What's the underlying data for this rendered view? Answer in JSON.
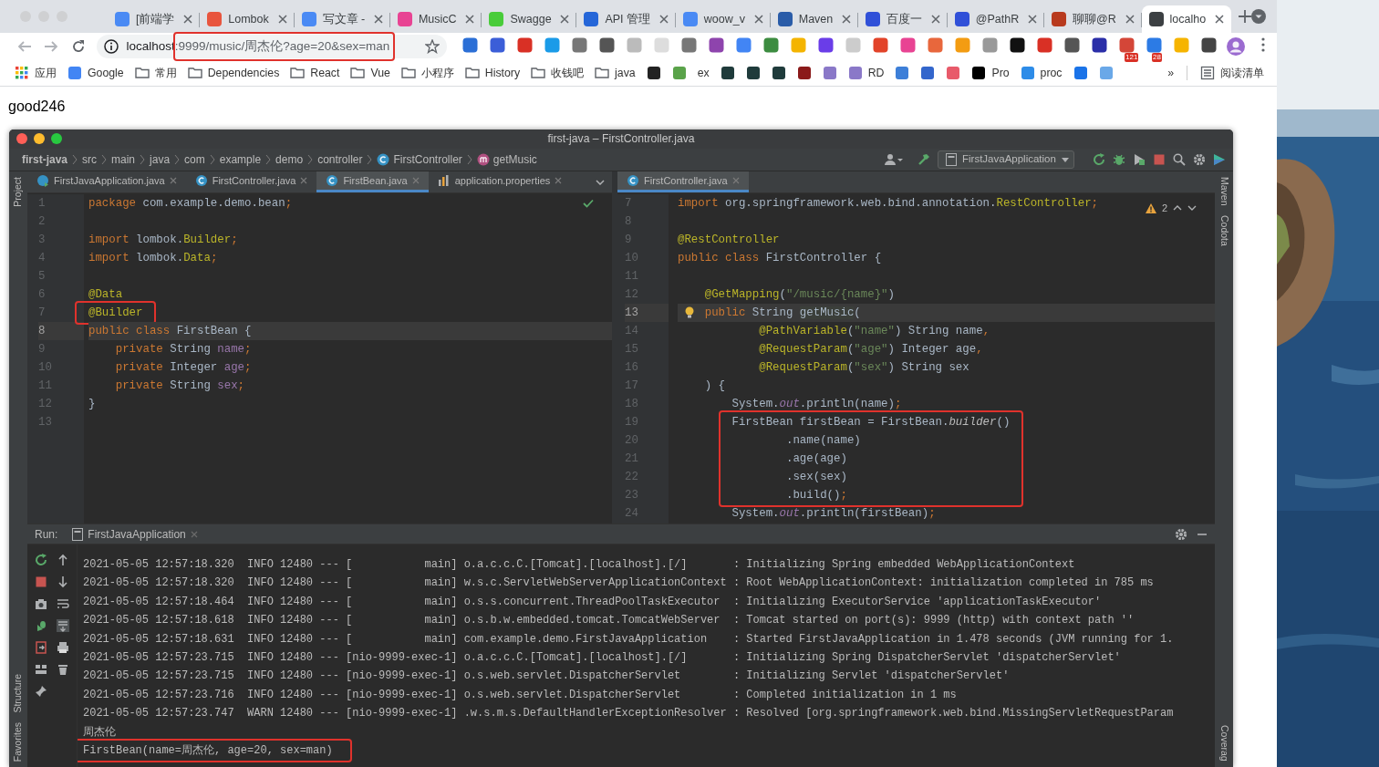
{
  "browser": {
    "tabs": [
      {
        "title": "[前端学",
        "color": "#4a8af4",
        "selected": false
      },
      {
        "title": "Lombok",
        "color": "#e8553e",
        "selected": false
      },
      {
        "title": "写文章 -",
        "color": "#4a8af4",
        "selected": false
      },
      {
        "title": "MusicC",
        "color": "#e84393",
        "selected": false
      },
      {
        "title": "Swagge",
        "color": "#49cc3a",
        "selected": false
      },
      {
        "title": "API 管理",
        "color": "#2566d8",
        "selected": false
      },
      {
        "title": "woow_v",
        "color": "#4a8af4",
        "selected": false
      },
      {
        "title": "Maven",
        "color": "#2a5ca8",
        "selected": false
      },
      {
        "title": "百度一",
        "color": "#3050d8",
        "selected": false
      },
      {
        "title": "@PathR",
        "color": "#3050d8",
        "selected": false
      },
      {
        "title": "聊聊@R",
        "color": "#b83a1e",
        "selected": false
      },
      {
        "title": "localho",
        "color": "#3c4043",
        "selected": true
      }
    ],
    "address": {
      "host": "localhost",
      "rest": ":9999/music/周杰伦?age=20&sex=man",
      "highlighted": true
    },
    "extensions": [
      {
        "color": "#2b6fd6"
      },
      {
        "color": "#3b5ed8"
      },
      {
        "color": "#d93025"
      },
      {
        "color": "#1a9be8"
      },
      {
        "color": "#777777"
      },
      {
        "color": "#555555"
      },
      {
        "color": "#bbbbbb"
      },
      {
        "color": "#dddddd"
      },
      {
        "color": "#777777"
      },
      {
        "color": "#8e44ad"
      },
      {
        "color": "#4285f4"
      },
      {
        "color": "#3c8c40"
      },
      {
        "color": "#f4b400"
      },
      {
        "color": "#6a3de8"
      },
      {
        "color": "#cccccc"
      },
      {
        "color": "#e24329"
      },
      {
        "color": "#e84393"
      },
      {
        "color": "#e8673c"
      },
      {
        "color": "#f39c12"
      },
      {
        "color": "#999999"
      },
      {
        "color": "#111111"
      },
      {
        "color": "#d93025"
      },
      {
        "color": "#555555"
      },
      {
        "color": "#2a2ea8"
      },
      {
        "color": "#d44638",
        "badge": "121"
      },
      {
        "color": "#2c7be5",
        "badge": "28"
      },
      {
        "color": "#f6b400"
      },
      {
        "color": "#444444"
      }
    ],
    "bookmarks": [
      {
        "kind": "apps",
        "label": "应用"
      },
      {
        "kind": "site",
        "label": "Google",
        "color": "#4285f4"
      },
      {
        "kind": "folder",
        "label": "常用"
      },
      {
        "kind": "folder",
        "label": "Dependencies"
      },
      {
        "kind": "folder",
        "label": "React"
      },
      {
        "kind": "folder",
        "label": "Vue"
      },
      {
        "kind": "folder",
        "label": "小程序"
      },
      {
        "kind": "folder",
        "label": "History"
      },
      {
        "kind": "folder",
        "label": "收钱吧"
      },
      {
        "kind": "folder",
        "label": "java"
      },
      {
        "kind": "site",
        "color": "#222222"
      },
      {
        "kind": "site",
        "color": "#5aa34a"
      },
      {
        "kind": "site",
        "label": "ex"
      },
      {
        "kind": "site",
        "color": "#1f3b3b"
      },
      {
        "kind": "site",
        "color": "#1f3b3b"
      },
      {
        "kind": "site",
        "color": "#1f3b3b"
      },
      {
        "kind": "site",
        "color": "#8b1a1a"
      },
      {
        "kind": "site",
        "color": "#8a78c8"
      },
      {
        "kind": "site",
        "label": "RD",
        "color": "#8a78c8"
      },
      {
        "kind": "site",
        "color": "#3d7fd8"
      },
      {
        "kind": "site",
        "color": "#3366cc"
      },
      {
        "kind": "site",
        "color": "#e85a6a"
      },
      {
        "kind": "site",
        "label": "Pro",
        "color": "#000000"
      },
      {
        "kind": "site",
        "label": "proc",
        "color": "#2d8ce8"
      },
      {
        "kind": "site",
        "color": "#1a73e8"
      },
      {
        "kind": "site",
        "color": "#6aa8e8"
      }
    ],
    "more": "»",
    "reading_list": "阅读清单"
  },
  "page": {
    "text": "good246"
  },
  "ide": {
    "title": "first-java – FirstController.java",
    "breadcrumbs": [
      {
        "label": "first-java",
        "kind": "project"
      },
      {
        "label": "src",
        "kind": "dir"
      },
      {
        "label": "main",
        "kind": "dir"
      },
      {
        "label": "java",
        "kind": "dir"
      },
      {
        "label": "com",
        "kind": "dir"
      },
      {
        "label": "example",
        "kind": "dir"
      },
      {
        "label": "demo",
        "kind": "dir"
      },
      {
        "label": "controller",
        "kind": "dir"
      },
      {
        "label": "FirstController",
        "kind": "class"
      },
      {
        "label": "getMusic",
        "kind": "method"
      }
    ],
    "run_config": "FirstJavaApplication",
    "left_strip": {
      "top": [
        "Project"
      ],
      "bottom": [
        "Structure",
        "Favorites"
      ]
    },
    "right_strip": {
      "top": [
        "Maven",
        "Codota"
      ],
      "bottom": [
        "Coverag"
      ]
    },
    "editors": [
      {
        "tabs": [
          {
            "label": "FirstJavaApplication.java",
            "kind": "app",
            "selected": false
          },
          {
            "label": "FirstController.java",
            "kind": "class",
            "selected": false
          },
          {
            "label": "FirstBean.java",
            "kind": "class",
            "selected": true
          },
          {
            "label": "application.properties",
            "kind": "properties",
            "selected": false
          }
        ],
        "kind": "ok",
        "lines": [
          {
            "number": "1",
            "current": false,
            "highlighted": false,
            "tokens": [
              {
                "text": "package",
                "kind": "kw"
              },
              {
                "text": " com.example.demo.bean",
                "kind": "plain"
              },
              {
                "text": ";",
                "kind": "kw"
              }
            ]
          },
          {
            "number": "2",
            "current": false,
            "highlighted": false
          },
          {
            "number": "3",
            "current": false,
            "highlighted": false,
            "tokens": [
              {
                "text": "import",
                "kind": "kw"
              },
              {
                "text": " lombok.",
                "kind": "plain"
              },
              {
                "text": "Builder",
                "kind": "ann"
              },
              {
                "text": ";",
                "kind": "kw"
              }
            ]
          },
          {
            "number": "4",
            "current": false,
            "highlighted": false,
            "tokens": [
              {
                "text": "import",
                "kind": "kw"
              },
              {
                "text": " lombok.",
                "kind": "plain"
              },
              {
                "text": "Data",
                "kind": "ann"
              },
              {
                "text": ";",
                "kind": "kw"
              }
            ]
          },
          {
            "number": "5",
            "current": false,
            "highlighted": false
          },
          {
            "number": "6",
            "current": false,
            "highlighted": false,
            "tokens": [
              {
                "text": "@Data",
                "kind": "ann"
              }
            ]
          },
          {
            "number": "7",
            "current": false,
            "highlighted": true,
            "tokens": [
              {
                "text": "@Builder",
                "kind": "ann"
              }
            ]
          },
          {
            "number": "8",
            "current": true,
            "highlighted": false,
            "tokens": [
              {
                "text": "public class",
                "kind": "kw"
              },
              {
                "text": " FirstBean {",
                "kind": "plain"
              }
            ]
          },
          {
            "number": "9",
            "current": false,
            "highlighted": false,
            "tokens": [
              {
                "text": "    private",
                "kind": "kw"
              },
              {
                "text": " String ",
                "kind": "plain"
              },
              {
                "text": "name",
                "kind": "field"
              },
              {
                "text": ";",
                "kind": "kw"
              }
            ]
          },
          {
            "number": "10",
            "current": false,
            "highlighted": false,
            "tokens": [
              {
                "text": "    private",
                "kind": "kw"
              },
              {
                "text": " Integer ",
                "kind": "plain"
              },
              {
                "text": "age",
                "kind": "field"
              },
              {
                "text": ";",
                "kind": "kw"
              }
            ]
          },
          {
            "number": "11",
            "current": false,
            "highlighted": false,
            "tokens": [
              {
                "text": "    private",
                "kind": "kw"
              },
              {
                "text": " String ",
                "kind": "plain"
              },
              {
                "text": "sex",
                "kind": "field"
              },
              {
                "text": ";",
                "kind": "kw"
              }
            ]
          },
          {
            "number": "12",
            "current": false,
            "highlighted": false,
            "tokens": [
              {
                "text": "}",
                "kind": "plain"
              }
            ]
          },
          {
            "number": "13",
            "current": false,
            "highlighted": false
          }
        ]
      },
      {
        "tabs": [
          {
            "label": "FirstController.java",
            "kind": "class",
            "selected": true
          }
        ],
        "kind": "warning",
        "warnings": "2",
        "lines": [
          {
            "number": "7",
            "current": false,
            "highlighted": false,
            "tokens": [
              {
                "text": "import",
                "kind": "kw"
              },
              {
                "text": " org.springframework.web.bind.annotation.",
                "kind": "plain"
              },
              {
                "text": "RestController",
                "kind": "ann"
              },
              {
                "text": ";",
                "kind": "kw"
              }
            ]
          },
          {
            "number": "8",
            "current": false,
            "highlighted": false
          },
          {
            "number": "9",
            "current": false,
            "highlighted": false,
            "tokens": [
              {
                "text": "@RestController",
                "kind": "ann"
              }
            ]
          },
          {
            "number": "10",
            "current": false,
            "highlighted": false,
            "tokens": [
              {
                "text": "public class",
                "kind": "kw"
              },
              {
                "text": " FirstController {",
                "kind": "plain"
              }
            ]
          },
          {
            "number": "11",
            "current": false,
            "highlighted": false
          },
          {
            "number": "12",
            "current": false,
            "highlighted": false,
            "tokens": [
              {
                "text": "    @GetMapping",
                "kind": "ann"
              },
              {
                "text": "(",
                "kind": "plain"
              },
              {
                "text": "\"/music/{name}\"",
                "kind": "str"
              },
              {
                "text": ")",
                "kind": "plain"
              }
            ]
          },
          {
            "number": "13",
            "current": true,
            "highlighted": false,
            "kind": "bulb",
            "tokens": [
              {
                "text": "    public",
                "kind": "kw"
              },
              {
                "text": " String ",
                "kind": "plain"
              },
              {
                "text": "getMusic",
                "kind": "decl"
              },
              {
                "text": "(",
                "kind": "plain"
              }
            ]
          },
          {
            "number": "14",
            "current": false,
            "highlighted": false,
            "tokens": [
              {
                "text": "            @PathVariable",
                "kind": "ann"
              },
              {
                "text": "(",
                "kind": "plain"
              },
              {
                "text": "\"name\"",
                "kind": "str"
              },
              {
                "text": ") String name",
                "kind": "plain"
              },
              {
                "text": ",",
                "kind": "kw"
              }
            ]
          },
          {
            "number": "15",
            "current": false,
            "highlighted": false,
            "tokens": [
              {
                "text": "            @RequestParam",
                "kind": "ann"
              },
              {
                "text": "(",
                "kind": "plain"
              },
              {
                "text": "\"age\"",
                "kind": "str"
              },
              {
                "text": ") Integer age",
                "kind": "plain"
              },
              {
                "text": ",",
                "kind": "kw"
              }
            ]
          },
          {
            "number": "16",
            "current": false,
            "highlighted": false,
            "tokens": [
              {
                "text": "            @RequestParam",
                "kind": "ann"
              },
              {
                "text": "(",
                "kind": "plain"
              },
              {
                "text": "\"sex\"",
                "kind": "str"
              },
              {
                "text": ") String sex",
                "kind": "plain"
              }
            ]
          },
          {
            "number": "17",
            "current": false,
            "highlighted": false,
            "tokens": [
              {
                "text": "    ) {",
                "kind": "plain"
              }
            ]
          },
          {
            "number": "18",
            "current": false,
            "highlighted": false,
            "tokens": [
              {
                "text": "        System.",
                "kind": "plain"
              },
              {
                "text": "out",
                "kind": "static"
              },
              {
                "text": ".println(name)",
                "kind": "plain"
              },
              {
                "text": ";",
                "kind": "kw"
              }
            ]
          },
          {
            "number": "19",
            "current": false,
            "highlighted": true,
            "tokens": [
              {
                "text": "        FirstBean firstBean = FirstBean.",
                "kind": "plain"
              },
              {
                "text": "builder",
                "kind": "italic"
              },
              {
                "text": "()",
                "kind": "plain"
              }
            ]
          },
          {
            "number": "20",
            "current": false,
            "highlighted": true,
            "tokens": [
              {
                "text": "                .name(name)",
                "kind": "plain"
              }
            ]
          },
          {
            "number": "21",
            "current": false,
            "highlighted": true,
            "tokens": [
              {
                "text": "                .age(age)",
                "kind": "plain"
              }
            ]
          },
          {
            "number": "22",
            "current": false,
            "highlighted": true,
            "tokens": [
              {
                "text": "                .sex(sex)",
                "kind": "plain"
              }
            ]
          },
          {
            "number": "23",
            "current": false,
            "highlighted": true,
            "tokens": [
              {
                "text": "                .build()",
                "kind": "plain"
              },
              {
                "text": ";",
                "kind": "kw"
              }
            ]
          },
          {
            "number": "24",
            "current": false,
            "highlighted": false,
            "tokens": [
              {
                "text": "        System.",
                "kind": "plain"
              },
              {
                "text": "out",
                "kind": "static"
              },
              {
                "text": ".println(firstBean)",
                "kind": "plain"
              },
              {
                "text": ";",
                "kind": "kw"
              }
            ]
          }
        ]
      }
    ],
    "run": {
      "label": "Run:",
      "tab": "FirstJavaApplication",
      "lines": [
        {
          "text": "2021-05-05 12:57:18.320  INFO 12480 --- [           main] o.a.c.c.C.[Tomcat].[localhost].[/]       : Initializing Spring embedded WebApplicationContext",
          "highlighted": false
        },
        {
          "text": "2021-05-05 12:57:18.320  INFO 12480 --- [           main] w.s.c.ServletWebServerApplicationContext : Root WebApplicationContext: initialization completed in 785 ms",
          "highlighted": false
        },
        {
          "text": "2021-05-05 12:57:18.464  INFO 12480 --- [           main] o.s.s.concurrent.ThreadPoolTaskExecutor  : Initializing ExecutorService 'applicationTaskExecutor'",
          "highlighted": false
        },
        {
          "text": "2021-05-05 12:57:18.618  INFO 12480 --- [           main] o.s.b.w.embedded.tomcat.TomcatWebServer  : Tomcat started on port(s): 9999 (http) with context path ''",
          "highlighted": false
        },
        {
          "text": "2021-05-05 12:57:18.631  INFO 12480 --- [           main] com.example.demo.FirstJavaApplication    : Started FirstJavaApplication in 1.478 seconds (JVM running for 1.",
          "highlighted": false
        },
        {
          "text": "2021-05-05 12:57:23.715  INFO 12480 --- [nio-9999-exec-1] o.a.c.c.C.[Tomcat].[localhost].[/]       : Initializing Spring DispatcherServlet 'dispatcherServlet'",
          "highlighted": false
        },
        {
          "text": "2021-05-05 12:57:23.715  INFO 12480 --- [nio-9999-exec-1] o.s.web.servlet.DispatcherServlet        : Initializing Servlet 'dispatcherServlet'",
          "highlighted": false
        },
        {
          "text": "2021-05-05 12:57:23.716  INFO 12480 --- [nio-9999-exec-1] o.s.web.servlet.DispatcherServlet        : Completed initialization in 1 ms",
          "highlighted": false
        },
        {
          "text": "2021-05-05 12:57:23.747  WARN 12480 --- [nio-9999-exec-1] .w.s.m.s.DefaultHandlerExceptionResolver : Resolved [org.springframework.web.bind.MissingServletRequestParam",
          "highlighted": false
        },
        {
          "text": "周杰伦",
          "highlighted": false
        },
        {
          "text": "FirstBean(name=周杰伦, age=20, sex=man)",
          "highlighted": true
        }
      ]
    }
  }
}
